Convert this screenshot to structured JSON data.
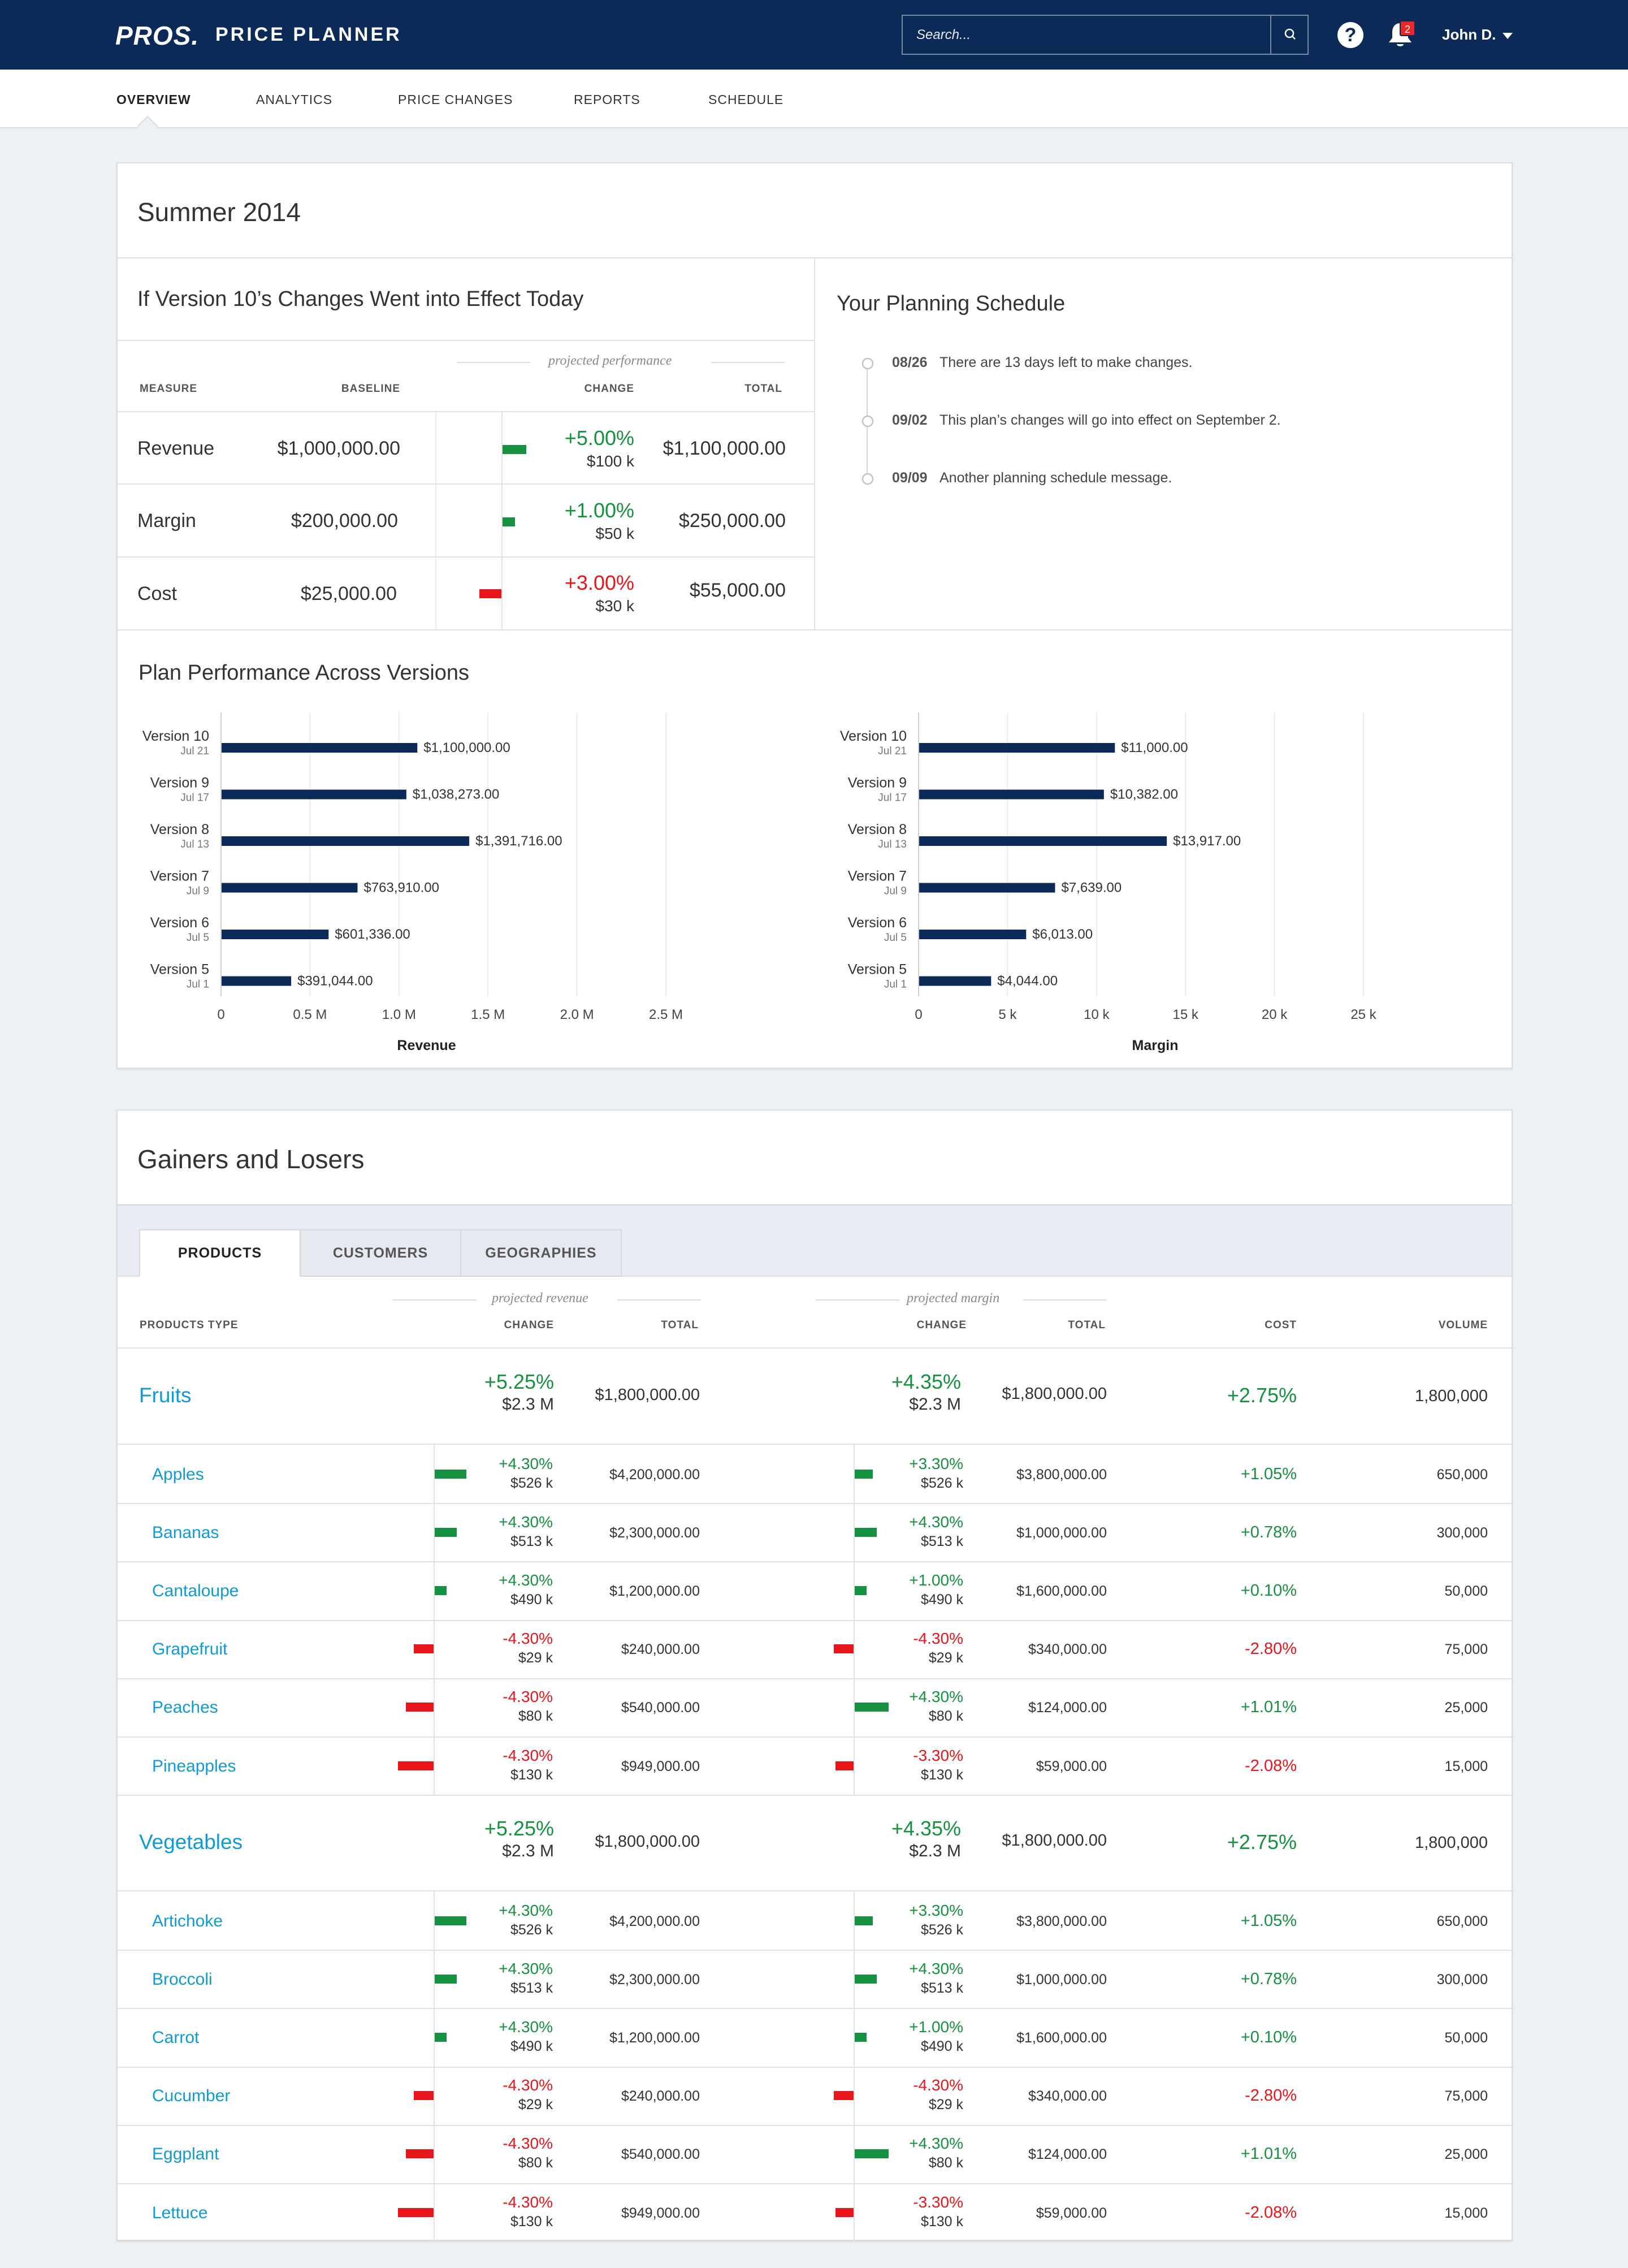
{
  "header": {
    "logo": "PROS.",
    "app_name": "PRICE PLANNER",
    "search_placeholder": "Search...",
    "notification_count": "2",
    "user": "John D."
  },
  "nav": {
    "tabs": [
      "OVERVIEW",
      "ANALYTICS",
      "PRICE CHANGES",
      "REPORTS",
      "SCHEDULE"
    ],
    "active": "OVERVIEW"
  },
  "plan": {
    "title": "Summer 2014",
    "impact": {
      "title": "If Version 10’s Changes Went into Effect Today",
      "projected_label": "projected performance",
      "columns": [
        "MEASURE",
        "BASELINE",
        "CHANGE",
        "TOTAL"
      ],
      "rows": [
        {
          "measure": "Revenue",
          "baseline": "$1,000,000.00",
          "change": "+5.00%",
          "change_amount": "$100 k",
          "total": "$1,100,000.00",
          "direction": "up",
          "magnitude": 0.05
        },
        {
          "measure": "Margin",
          "baseline": "$200,000.00",
          "change": "+1.00%",
          "change_amount": "$50 k",
          "total": "$250,000.00",
          "direction": "up",
          "magnitude": 0.01
        },
        {
          "measure": "Cost",
          "baseline": "$25,000.00",
          "change": "+3.00%",
          "change_amount": "$30 k",
          "total": "$55,000.00",
          "direction": "down",
          "magnitude": 0.03
        }
      ]
    },
    "schedule": {
      "title": "Your Planning Schedule",
      "items": [
        {
          "date": "08/26",
          "text": "There are 13 days left to make changes."
        },
        {
          "date": "09/02",
          "text": "This plan’s changes will go into effect on September 2."
        },
        {
          "date": "09/09",
          "text": "Another planning schedule message."
        }
      ]
    },
    "performance_title": "Plan Performance Across Versions"
  },
  "chart_data": [
    {
      "type": "bar",
      "orientation": "horizontal",
      "xlabel": "Revenue",
      "xlim": [
        0,
        2500000
      ],
      "ticks": [
        "0",
        "0.5 M",
        "1.0 M",
        "1.5 M",
        "2.0 M",
        "2.5 M"
      ],
      "categories": [
        "Version 10",
        "Version 9",
        "Version 8",
        "Version 7",
        "Version 6",
        "Version 5"
      ],
      "dates": [
        "Jul 21",
        "Jul 17",
        "Jul 13",
        "Jul 9",
        "Jul 5",
        "Jul 1"
      ],
      "values": [
        1100000,
        1038273,
        1391716,
        763910,
        601336,
        391044
      ],
      "labels": [
        "$1,100,000.00",
        "$1,038,273.00",
        "$1,391,716.00",
        "$763,910.00",
        "$601,336.00",
        "$391,044.00"
      ],
      "bar_color": "#0b2a58",
      "grid": true
    },
    {
      "type": "bar",
      "orientation": "horizontal",
      "xlabel": "Margin",
      "xlim": [
        0,
        25000
      ],
      "ticks": [
        "0",
        "5 k",
        "10 k",
        "15 k",
        "20 k",
        "25 k"
      ],
      "categories": [
        "Version 10",
        "Version 9",
        "Version 8",
        "Version 7",
        "Version 6",
        "Version 5"
      ],
      "dates": [
        "Jul 21",
        "Jul 17",
        "Jul 13",
        "Jul 9",
        "Jul 5",
        "Jul 1"
      ],
      "values": [
        11000,
        10382,
        13917,
        7639,
        6013,
        4044
      ],
      "labels": [
        "$11,000.00",
        "$10,382.00",
        "$13,917.00",
        "$7,639.00",
        "$6,013.00",
        "$4,044.00"
      ],
      "bar_color": "#0b2a58",
      "grid": true
    }
  ],
  "gainers": {
    "title": "Gainers and Losers",
    "tabs": [
      "PRODUCTS",
      "CUSTOMERS",
      "GEOGRAPHIES"
    ],
    "active_tab": "PRODUCTS",
    "projected_revenue_label": "projected revenue",
    "projected_margin_label": "projected margin",
    "columns": [
      "PRODUCTS TYPE",
      "CHANGE",
      "TOTAL",
      "CHANGE",
      "TOTAL",
      "COST",
      "VOLUME"
    ],
    "groups": [
      {
        "name": "Fruits",
        "rev_change": "+5.25%",
        "rev_amount": "$2.3 M",
        "rev_total": "$1,800,000.00",
        "mar_change": "+4.35%",
        "mar_amount": "$2.3 M",
        "mar_total": "$1,800,000.00",
        "cost": "+2.75%",
        "volume": "1,800,000",
        "items": [
          {
            "name": "Apples",
            "rev_change": "+4.30%",
            "rev_amount": "$526 k",
            "rev_dir": "up",
            "rev_mag": 0.8,
            "rev_total": "$4,200,000.00",
            "mar_change": "+3.30%",
            "mar_amount": "$526 k",
            "mar_dir": "up",
            "mar_mag": 0.45,
            "mar_total": "$3,800,000.00",
            "cost": "+1.05%",
            "cost_dir": "up",
            "volume": "650,000"
          },
          {
            "name": "Bananas",
            "rev_change": "+4.30%",
            "rev_amount": "$513 k",
            "rev_dir": "up",
            "rev_mag": 0.55,
            "rev_total": "$2,300,000.00",
            "mar_change": "+4.30%",
            "mar_amount": "$513 k",
            "mar_dir": "up",
            "mar_mag": 0.55,
            "mar_total": "$1,000,000.00",
            "cost": "+0.78%",
            "cost_dir": "up",
            "volume": "300,000"
          },
          {
            "name": "Cantaloupe",
            "rev_change": "+4.30%",
            "rev_amount": "$490 k",
            "rev_dir": "up",
            "rev_mag": 0.3,
            "rev_total": "$1,200,000.00",
            "mar_change": "+1.00%",
            "mar_amount": "$490 k",
            "mar_dir": "up",
            "mar_mag": 0.3,
            "mar_total": "$1,600,000.00",
            "cost": "+0.10%",
            "cost_dir": "up",
            "volume": "50,000"
          },
          {
            "name": "Grapefruit",
            "rev_change": "-4.30%",
            "rev_amount": "$29 k",
            "rev_dir": "down",
            "rev_mag": 0.5,
            "rev_total": "$240,000.00",
            "mar_change": "-4.30%",
            "mar_amount": "$29 k",
            "mar_dir": "down",
            "mar_mag": 0.5,
            "mar_total": "$340,000.00",
            "cost": "-2.80%",
            "cost_dir": "down",
            "volume": "75,000"
          },
          {
            "name": "Peaches",
            "rev_change": "-4.30%",
            "rev_amount": "$80 k",
            "rev_dir": "down",
            "rev_mag": 0.7,
            "rev_total": "$540,000.00",
            "mar_change": "+4.30%",
            "mar_amount": "$80 k",
            "mar_dir": "up",
            "mar_mag": 0.85,
            "mar_total": "$124,000.00",
            "cost": "+1.01%",
            "cost_dir": "up",
            "volume": "25,000"
          },
          {
            "name": "Pineapples",
            "rev_change": "-4.30%",
            "rev_amount": "$130 k",
            "rev_dir": "down",
            "rev_mag": 0.9,
            "rev_total": "$949,000.00",
            "mar_change": "-3.30%",
            "mar_amount": "$130 k",
            "mar_dir": "down",
            "mar_mag": 0.45,
            "mar_total": "$59,000.00",
            "cost": "-2.08%",
            "cost_dir": "down",
            "volume": "15,000"
          }
        ]
      },
      {
        "name": "Vegetables",
        "rev_change": "+5.25%",
        "rev_amount": "$2.3 M",
        "rev_total": "$1,800,000.00",
        "mar_change": "+4.35%",
        "mar_amount": "$2.3 M",
        "mar_total": "$1,800,000.00",
        "cost": "+2.75%",
        "volume": "1,800,000",
        "items": [
          {
            "name": "Artichoke",
            "rev_change": "+4.30%",
            "rev_amount": "$526 k",
            "rev_dir": "up",
            "rev_mag": 0.8,
            "rev_total": "$4,200,000.00",
            "mar_change": "+3.30%",
            "mar_amount": "$526 k",
            "mar_dir": "up",
            "mar_mag": 0.45,
            "mar_total": "$3,800,000.00",
            "cost": "+1.05%",
            "cost_dir": "up",
            "volume": "650,000"
          },
          {
            "name": "Broccoli",
            "rev_change": "+4.30%",
            "rev_amount": "$513 k",
            "rev_dir": "up",
            "rev_mag": 0.55,
            "rev_total": "$2,300,000.00",
            "mar_change": "+4.30%",
            "mar_amount": "$513 k",
            "mar_dir": "up",
            "mar_mag": 0.55,
            "mar_total": "$1,000,000.00",
            "cost": "+0.78%",
            "cost_dir": "up",
            "volume": "300,000"
          },
          {
            "name": "Carrot",
            "rev_change": "+4.30%",
            "rev_amount": "$490 k",
            "rev_dir": "up",
            "rev_mag": 0.3,
            "rev_total": "$1,200,000.00",
            "mar_change": "+1.00%",
            "mar_amount": "$490 k",
            "mar_dir": "up",
            "mar_mag": 0.3,
            "mar_total": "$1,600,000.00",
            "cost": "+0.10%",
            "cost_dir": "up",
            "volume": "50,000"
          },
          {
            "name": "Cucumber",
            "rev_change": "-4.30%",
            "rev_amount": "$29 k",
            "rev_dir": "down",
            "rev_mag": 0.5,
            "rev_total": "$240,000.00",
            "mar_change": "-4.30%",
            "mar_amount": "$29 k",
            "mar_dir": "down",
            "mar_mag": 0.5,
            "mar_total": "$340,000.00",
            "cost": "-2.80%",
            "cost_dir": "down",
            "volume": "75,000"
          },
          {
            "name": "Eggplant",
            "rev_change": "-4.30%",
            "rev_amount": "$80 k",
            "rev_dir": "down",
            "rev_mag": 0.7,
            "rev_total": "$540,000.00",
            "mar_change": "+4.30%",
            "mar_amount": "$80 k",
            "mar_dir": "up",
            "mar_mag": 0.85,
            "mar_total": "$124,000.00",
            "cost": "+1.01%",
            "cost_dir": "up",
            "volume": "25,000"
          },
          {
            "name": "Lettuce",
            "rev_change": "-4.30%",
            "rev_amount": "$130 k",
            "rev_dir": "down",
            "rev_mag": 0.9,
            "rev_total": "$949,000.00",
            "mar_change": "-3.30%",
            "mar_amount": "$130 k",
            "mar_dir": "down",
            "mar_mag": 0.45,
            "mar_total": "$59,000.00",
            "cost": "-2.08%",
            "cost_dir": "down",
            "volume": "15,000"
          }
        ]
      }
    ]
  },
  "colors": {
    "navy": "#0b2a58",
    "green": "#16913f",
    "red": "#e8161b",
    "link": "#0e9bd6"
  },
  "icons": [
    "search-icon",
    "help-icon",
    "bell-icon",
    "chevron-down-icon"
  ]
}
